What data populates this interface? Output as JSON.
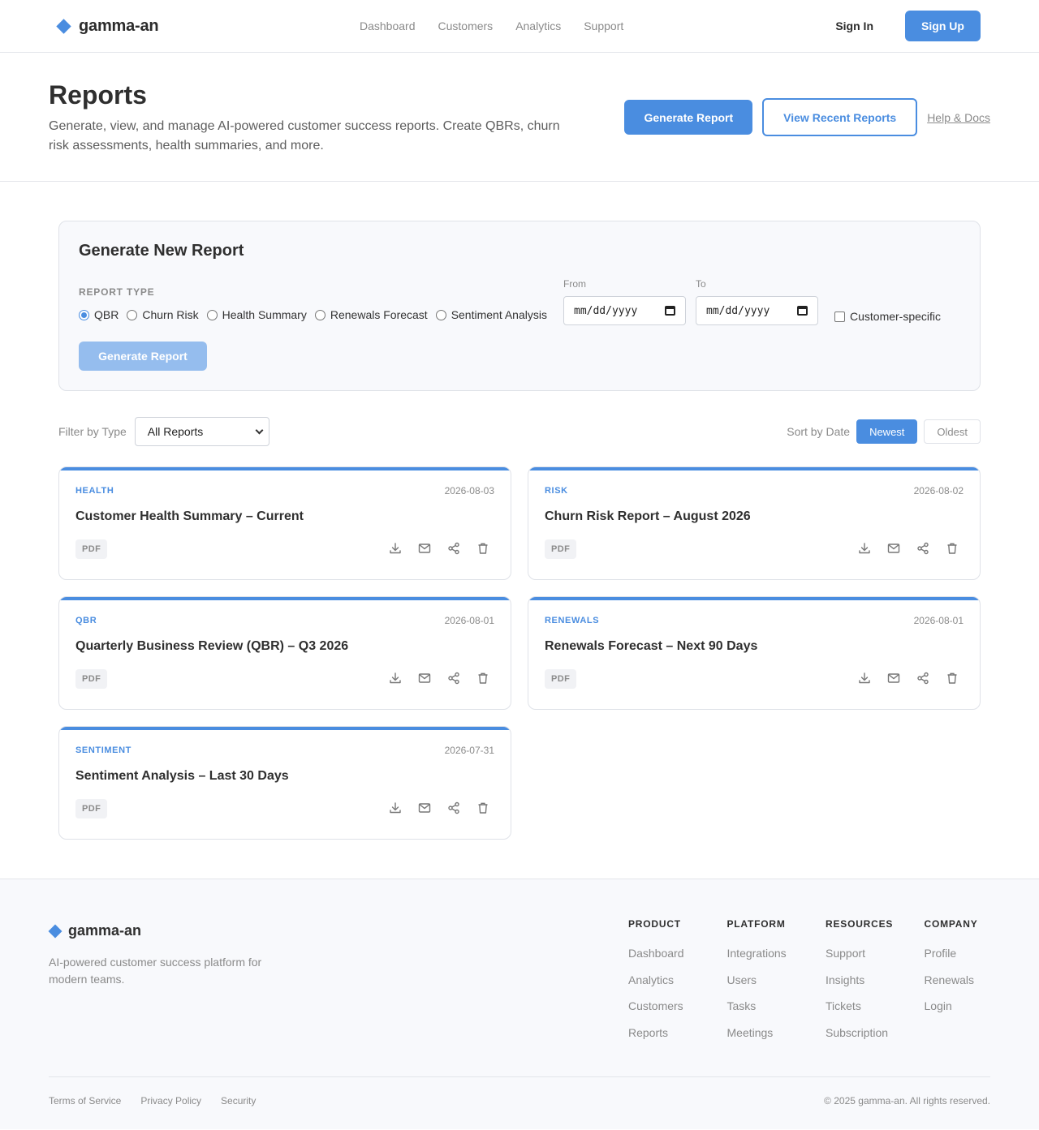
{
  "header": {
    "brand": "gamma-an",
    "nav": [
      "Dashboard",
      "Customers",
      "Analytics",
      "Support"
    ],
    "sign_in": "Sign In",
    "sign_up": "Sign Up"
  },
  "hero": {
    "title": "Reports",
    "description": "Generate, view, and manage AI-powered customer success reports. Create QBRs, churn risk assessments, health summaries, and more.",
    "generate_btn": "Generate Report",
    "recent_btn": "View Recent Reports",
    "help_link": "Help & Docs"
  },
  "generator": {
    "title": "Generate New Report",
    "report_type_label": "REPORT TYPE",
    "report_types": [
      "QBR",
      "Churn Risk",
      "Health Summary",
      "Renewals Forecast",
      "Sentiment Analysis"
    ],
    "selected_type": "QBR",
    "from_label": "From",
    "to_label": "To",
    "date_placeholder": "mm/dd/yyyy",
    "customer_specific_label": "Customer-specific",
    "submit": "Generate Report"
  },
  "filters": {
    "filter_label": "Filter by Type",
    "filter_value": "All Reports",
    "sort_label": "Sort by Date",
    "sort_newest": "Newest",
    "sort_oldest": "Oldest",
    "active_sort": "Newest"
  },
  "reports": [
    {
      "type": "HEALTH",
      "date": "2026-08-03",
      "title": "Customer Health Summary – Current",
      "format": "PDF"
    },
    {
      "type": "RISK",
      "date": "2026-08-02",
      "title": "Churn Risk Report – August 2026",
      "format": "PDF"
    },
    {
      "type": "QBR",
      "date": "2026-08-01",
      "title": "Quarterly Business Review (QBR) – Q3 2026",
      "format": "PDF"
    },
    {
      "type": "RENEWALS",
      "date": "2026-08-01",
      "title": "Renewals Forecast – Next 90 Days",
      "format": "PDF"
    },
    {
      "type": "SENTIMENT",
      "date": "2026-07-31",
      "title": "Sentiment Analysis – Last 30 Days",
      "format": "PDF"
    }
  ],
  "card_actions": [
    "download-icon",
    "mail-icon",
    "share-icon",
    "trash-icon"
  ],
  "footer": {
    "brand": "gamma-an",
    "tagline": "AI-powered customer success platform for modern teams.",
    "columns": [
      {
        "heading": "PRODUCT",
        "links": [
          "Dashboard",
          "Analytics",
          "Customers",
          "Reports"
        ]
      },
      {
        "heading": "PLATFORM",
        "links": [
          "Integrations",
          "Users",
          "Tasks",
          "Meetings"
        ]
      },
      {
        "heading": "RESOURCES",
        "links": [
          "Support",
          "Insights",
          "Tickets",
          "Subscription"
        ]
      },
      {
        "heading": "COMPANY",
        "links": [
          "Profile",
          "Renewals",
          "Login"
        ]
      }
    ],
    "legal": [
      "Terms of Service",
      "Privacy Policy",
      "Security"
    ],
    "copyright": "© 2025 gamma-an. All rights reserved."
  },
  "colors": {
    "accent": "#4a8de0",
    "accent_disabled": "#95bdee",
    "text": "#2f2f2f",
    "muted": "#8a8a8a",
    "panel_bg": "#f8f9fc"
  }
}
